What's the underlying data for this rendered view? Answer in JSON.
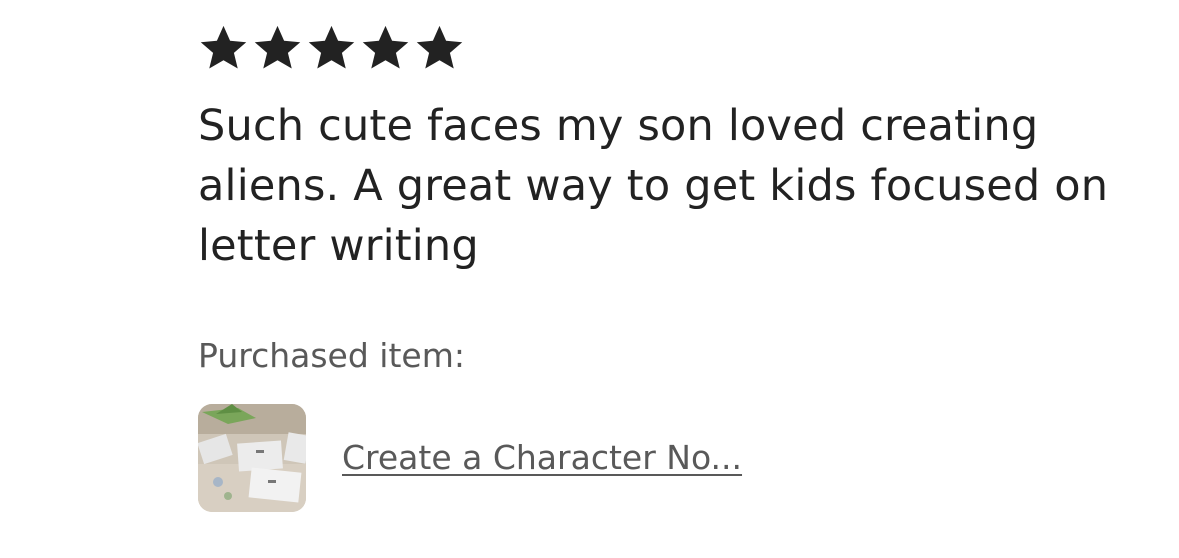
{
  "review": {
    "rating": 5,
    "rating_max": 5,
    "star_color": "#222222",
    "stars": [
      "star-icon",
      "star-icon",
      "star-icon",
      "star-icon",
      "star-icon"
    ],
    "text": "Such cute faces my son loved creating aliens. A great way to get kids focused on letter writing"
  },
  "purchased": {
    "label": "Purchased item:",
    "item_title": "Create a Character No...",
    "thumbnail_icon": "product-thumbnail"
  }
}
